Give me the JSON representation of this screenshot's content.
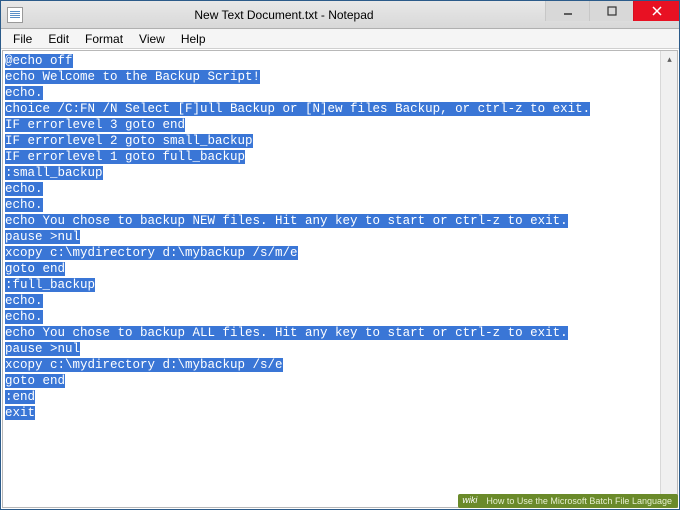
{
  "window": {
    "title": "New Text Document.txt - Notepad"
  },
  "menubar": {
    "items": [
      "File",
      "Edit",
      "Format",
      "View",
      "Help"
    ]
  },
  "editor": {
    "lines": [
      "@echo off",
      "echo Welcome to the Backup Script!",
      "echo.",
      "choice /C:FN /N Select [F]ull Backup or [N]ew files Backup, or ctrl-z to exit.",
      "IF errorlevel 3 goto end",
      "IF errorlevel 2 goto small_backup",
      "IF errorlevel 1 goto full_backup",
      ":small_backup",
      "echo.",
      "echo.",
      "echo You chose to backup NEW files. Hit any key to start or ctrl-z to exit.",
      "pause >nul",
      "xcopy c:\\mydirectory d:\\mybackup /s/m/e",
      "goto end",
      ":full_backup",
      "echo.",
      "echo.",
      "echo You chose to backup ALL files. Hit any key to start or ctrl-z to exit.",
      "pause >nul",
      "xcopy c:\\mydirectory d:\\mybackup /s/e",
      "goto end",
      ":end",
      "exit"
    ]
  },
  "watermark": {
    "brand": "wiki",
    "text": "How to Use the Microsoft Batch File Language"
  }
}
